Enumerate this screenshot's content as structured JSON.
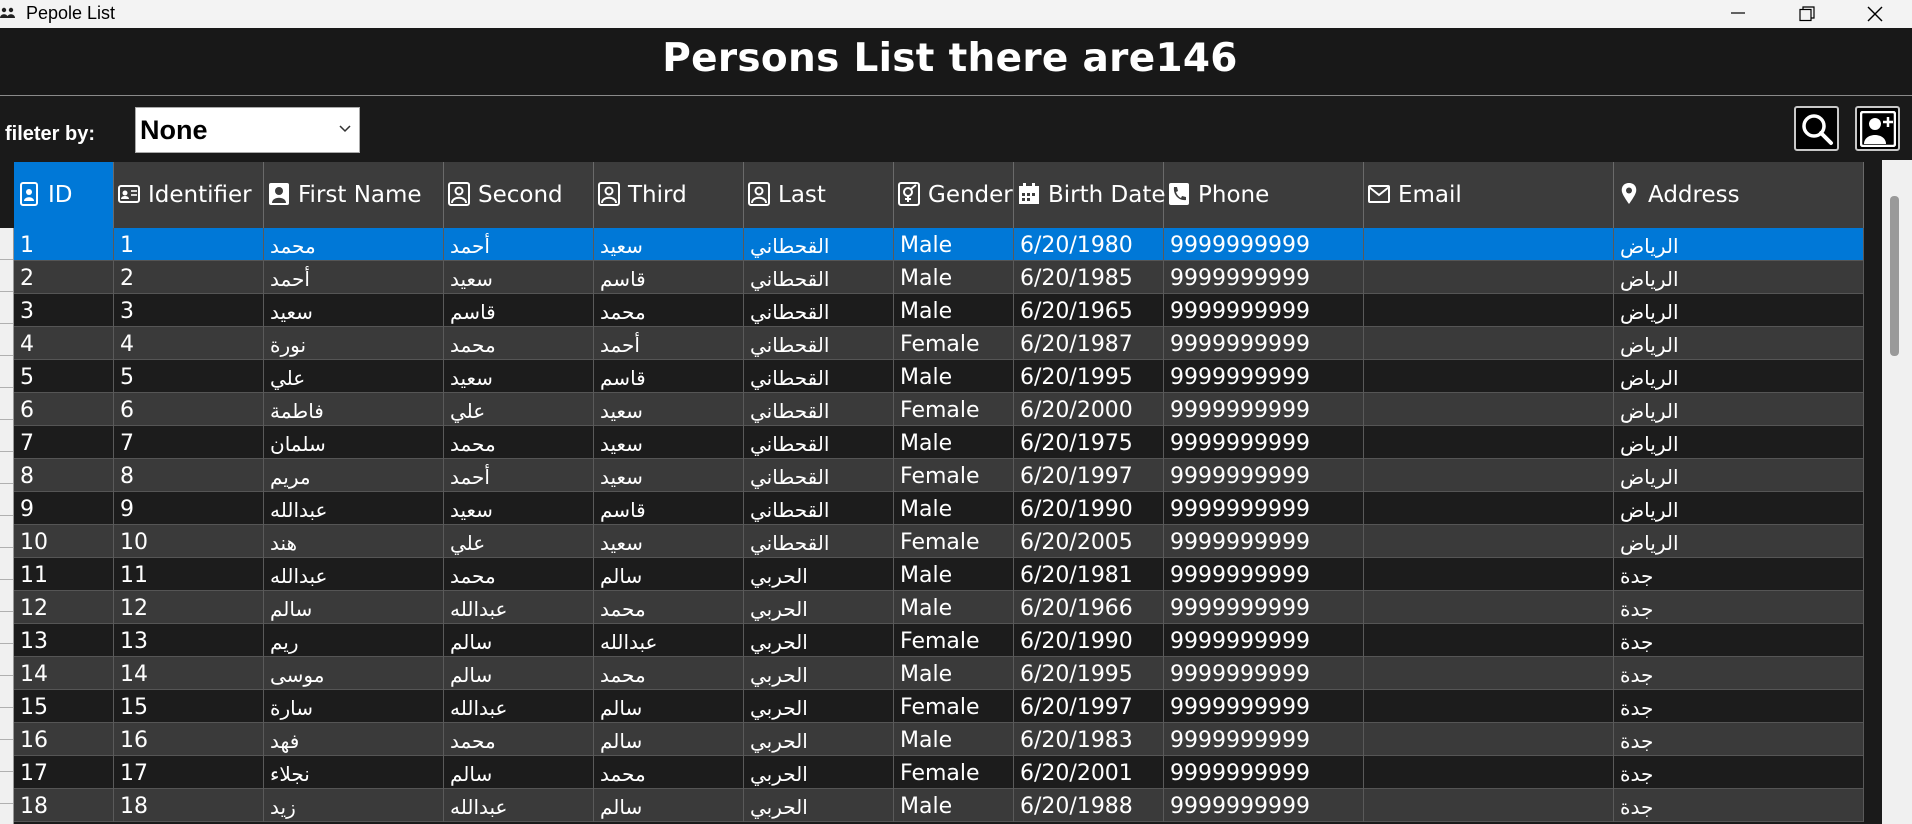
{
  "window": {
    "title": "Pepole List"
  },
  "header": {
    "title": "Persons List there are146"
  },
  "filter": {
    "label": "fileter by:",
    "selected": "None"
  },
  "toolbar": {
    "search_icon": "search-icon",
    "add_person_icon": "add-person-icon"
  },
  "colors": {
    "accent": "#0078d7",
    "row_dark": "#1c1c1c",
    "row_light": "#3a3a3a",
    "header_bg": "#3c3c3c"
  },
  "grid": {
    "columns": [
      {
        "label": "ID",
        "icon": "id-badge-icon"
      },
      {
        "label": "Identifier",
        "icon": "id-card-icon"
      },
      {
        "label": "First Name",
        "icon": "person-filled-icon"
      },
      {
        "label": "Second",
        "icon": "person-outline-icon"
      },
      {
        "label": "Third",
        "icon": "person-outline-icon"
      },
      {
        "label": "Last",
        "icon": "person-outline-icon"
      },
      {
        "label": "Gender",
        "icon": "gender-icon"
      },
      {
        "label": "Birth Date",
        "icon": "calendar-icon"
      },
      {
        "label": "Phone",
        "icon": "phone-icon"
      },
      {
        "label": "Email",
        "icon": "envelope-icon"
      },
      {
        "label": "Address",
        "icon": "location-pin-icon"
      }
    ],
    "rows": [
      [
        "1",
        "1",
        "محمد",
        "أحمد",
        "سعيد",
        "القحطاني",
        "Male",
        "6/20/1980",
        "9999999999",
        "",
        "الرياض"
      ],
      [
        "2",
        "2",
        "أحمد",
        "سعيد",
        "قاسم",
        "القحطاني",
        "Male",
        "6/20/1985",
        "9999999999",
        "",
        "الرياض"
      ],
      [
        "3",
        "3",
        "سعيد",
        "قاسم",
        "محمد",
        "القحطاني",
        "Male",
        "6/20/1965",
        "9999999999",
        "",
        "الرياض"
      ],
      [
        "4",
        "4",
        "نورة",
        "محمد",
        "أحمد",
        "القحطاني",
        "Female",
        "6/20/1987",
        "9999999999",
        "",
        "الرياض"
      ],
      [
        "5",
        "5",
        "علي",
        "سعيد",
        "قاسم",
        "القحطاني",
        "Male",
        "6/20/1995",
        "9999999999",
        "",
        "الرياض"
      ],
      [
        "6",
        "6",
        "فاطمة",
        "علي",
        "سعيد",
        "القحطاني",
        "Female",
        "6/20/2000",
        "9999999999",
        "",
        "الرياض"
      ],
      [
        "7",
        "7",
        "سلمان",
        "محمد",
        "سعيد",
        "القحطاني",
        "Male",
        "6/20/1975",
        "9999999999",
        "",
        "الرياض"
      ],
      [
        "8",
        "8",
        "مريم",
        "أحمد",
        "سعيد",
        "القحطاني",
        "Female",
        "6/20/1997",
        "9999999999",
        "",
        "الرياض"
      ],
      [
        "9",
        "9",
        "عبدالله",
        "سعيد",
        "قاسم",
        "القحطاني",
        "Male",
        "6/20/1990",
        "9999999999",
        "",
        "الرياض"
      ],
      [
        "10",
        "10",
        "هند",
        "علي",
        "سعيد",
        "القحطاني",
        "Female",
        "6/20/2005",
        "9999999999",
        "",
        "الرياض"
      ],
      [
        "11",
        "11",
        "عبدالله",
        "محمد",
        "سالم",
        "الحربي",
        "Male",
        "6/20/1981",
        "9999999999",
        "",
        "جدة"
      ],
      [
        "12",
        "12",
        "سالم",
        "عبدالله",
        "محمد",
        "الحربي",
        "Male",
        "6/20/1966",
        "9999999999",
        "",
        "جدة"
      ],
      [
        "13",
        "13",
        "ريم",
        "سالم",
        "عبدالله",
        "الحربي",
        "Female",
        "6/20/1990",
        "9999999999",
        "",
        "جدة"
      ],
      [
        "14",
        "14",
        "موسى",
        "سالم",
        "محمد",
        "الحربي",
        "Male",
        "6/20/1995",
        "9999999999",
        "",
        "جدة"
      ],
      [
        "15",
        "15",
        "سارة",
        "عبدالله",
        "سالم",
        "الحربي",
        "Female",
        "6/20/1997",
        "9999999999",
        "",
        "جدة"
      ],
      [
        "16",
        "16",
        "فهد",
        "محمد",
        "سالم",
        "الحربي",
        "Male",
        "6/20/1983",
        "9999999999",
        "",
        "جدة"
      ],
      [
        "17",
        "17",
        "نجلاء",
        "سالم",
        "محمد",
        "الحربي",
        "Female",
        "6/20/2001",
        "9999999999",
        "",
        "جدة"
      ],
      [
        "18",
        "18",
        "زيد",
        "عبدالله",
        "سالم",
        "الحربي",
        "Male",
        "6/20/1988",
        "9999999999",
        "",
        "جدة"
      ]
    ]
  }
}
